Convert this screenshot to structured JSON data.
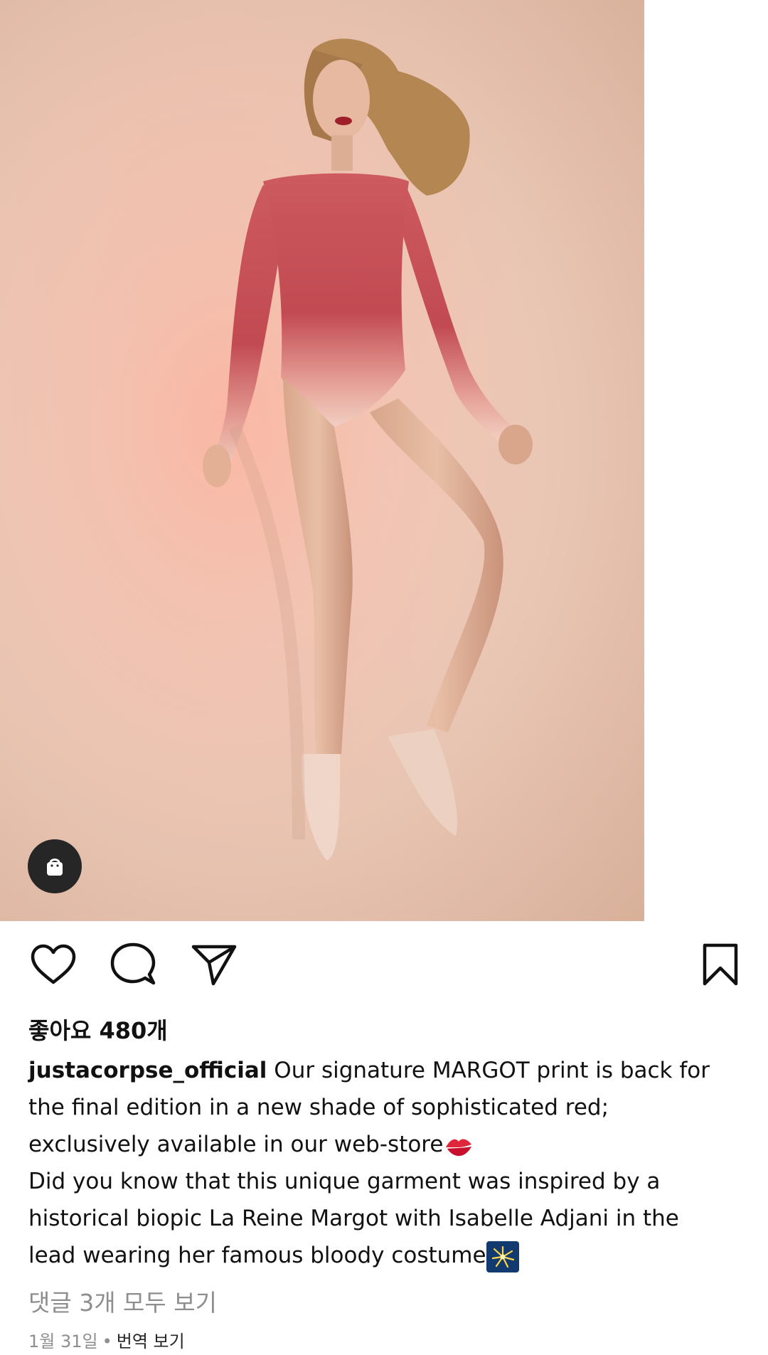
{
  "post": {
    "shop_icon": "shopping-bag-icon",
    "likes": "좋아요 480개",
    "username": "justacorpse_official",
    "caption_lines": [
      "Our signature MARGOT print is back for",
      "the final edition in a new shade of sophisticated red;",
      "exclusively available in our web-store",
      "Did you know that this unique garment was inspired by a",
      "historical biopic La Reine Margot with Isabelle Adjani in the",
      "lead wearing her famous bloody costume"
    ],
    "view_comments": "댓글 3개 모두 보기",
    "date": "1월 31일",
    "separator": "•",
    "translate": "번역 보기"
  },
  "actions": {
    "like_icon": "heart-icon",
    "comment_icon": "comment-bubble-icon",
    "share_icon": "paper-plane-icon",
    "save_icon": "bookmark-icon"
  },
  "colors": {
    "background": "#ffffff",
    "text": "#111111",
    "muted": "#8e8e8e",
    "shop_button": "#262626"
  }
}
